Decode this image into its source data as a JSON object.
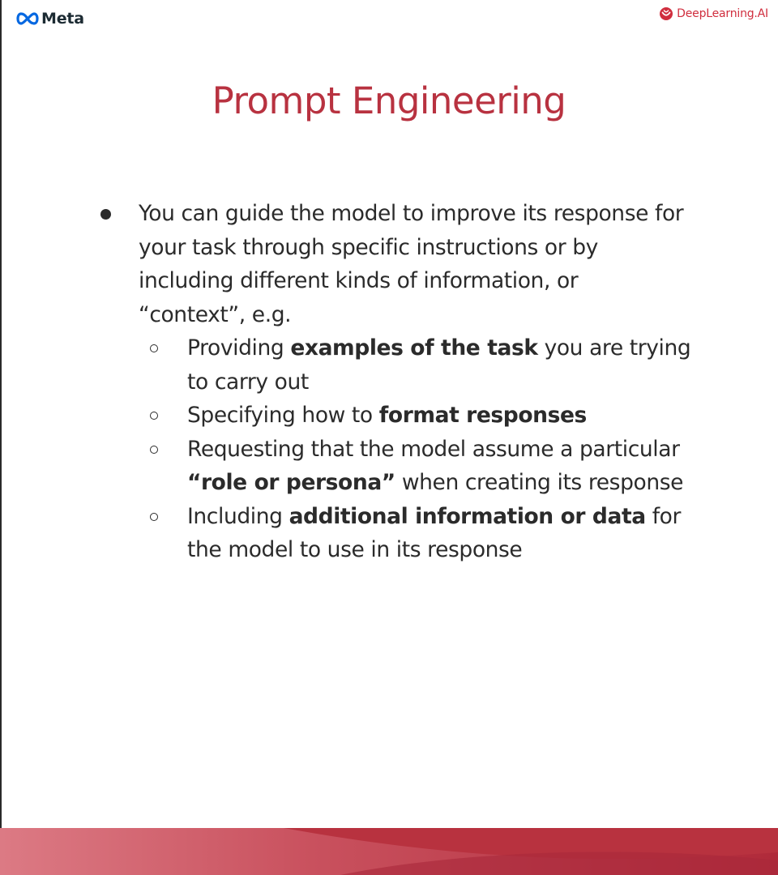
{
  "header": {
    "meta_label": "Meta",
    "dl_label": "DeepLearning.AI",
    "meta_icon": "meta-infinity-logo",
    "dl_icon": "deeplearning-smile-logo"
  },
  "slide": {
    "title": "Prompt Engineering",
    "main_bullet": "You can guide the model to improve its response for your task through specific instructions or by including different kinds of information, or “context”, e.g.",
    "sub_items": [
      {
        "pre": "Providing ",
        "bold": "examples of the task",
        "post": " you are trying to carry out"
      },
      {
        "pre": "Specifying how to ",
        "bold": "format responses",
        "post": ""
      },
      {
        "pre": "Requesting that the model assume a particular ",
        "bold": "“role or persona”",
        "post": " when creating its response"
      },
      {
        "pre": "Including ",
        "bold": "additional information or data",
        "post": " for the model to use in its response"
      }
    ]
  },
  "colors": {
    "title": "#b83240",
    "text": "#2b2b2b",
    "accent_red": "#d02e3e",
    "footer_dark": "#b02a3a",
    "footer_light": "#d9707b"
  }
}
